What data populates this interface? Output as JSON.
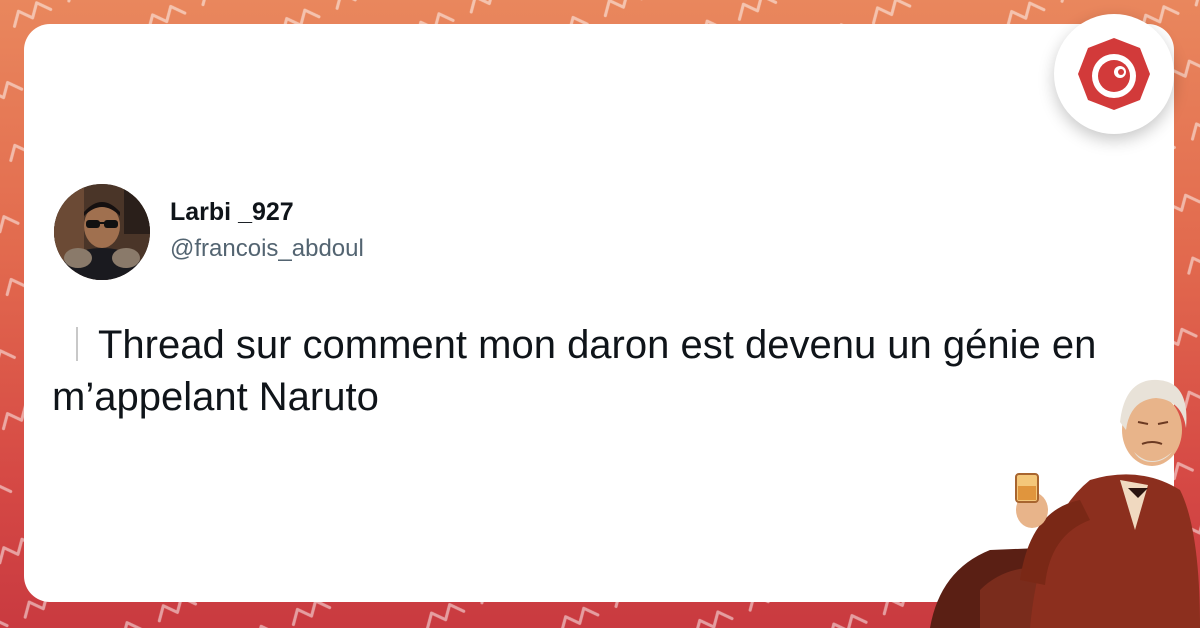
{
  "tweet": {
    "display_name": "Larbi _927",
    "handle": "@francois_abdoul",
    "text": "Thread sur comment mon daron est devenu un génie en m’appelant Naruto"
  },
  "icons": {
    "avatar": "profile-photo",
    "brand_logo": "brand-logo-icon",
    "mascot": "old-man-with-drink-illustration"
  },
  "colors": {
    "background_top": "#e9875d",
    "background_bottom": "#c93a40",
    "brand_red": "#d23a3a",
    "name": "#0f1419",
    "handle": "#536471"
  }
}
